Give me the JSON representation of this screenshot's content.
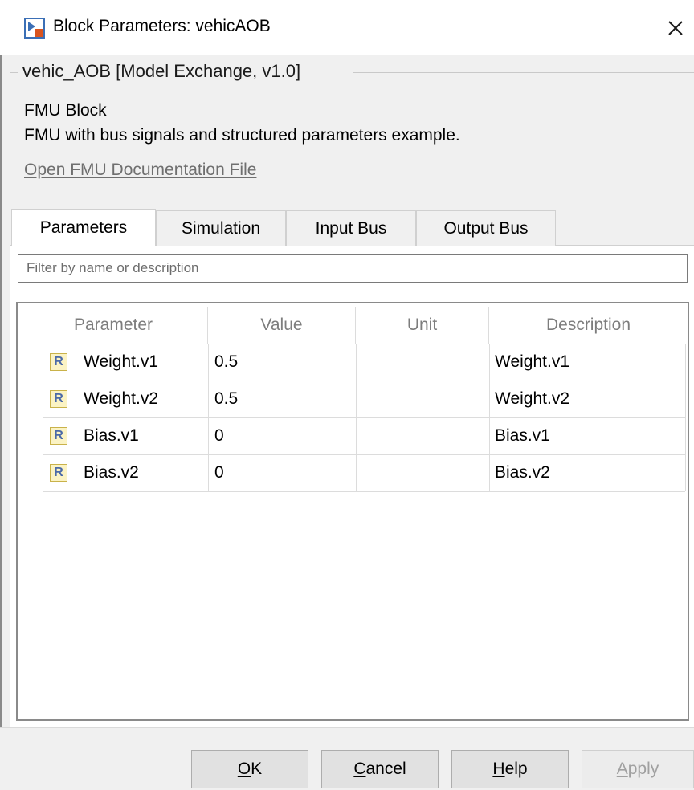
{
  "window": {
    "title": "Block Parameters: vehicAOB",
    "app_icon": "simulink-block-icon",
    "close_glyph": "✕"
  },
  "group": {
    "title": "vehic_AOB [Model Exchange, v1.0]",
    "block_type": "FMU Block",
    "description": "FMU with bus signals and structured parameters example.",
    "doc_link": "Open FMU Documentation File"
  },
  "tabs": [
    {
      "label": "Parameters",
      "active": true
    },
    {
      "label": "Simulation",
      "active": false
    },
    {
      "label": "Input Bus",
      "active": false
    },
    {
      "label": "Output Bus",
      "active": false
    }
  ],
  "filter": {
    "placeholder": "Filter by name or description",
    "value": ""
  },
  "table": {
    "columns": [
      "Parameter",
      "Value",
      "Unit",
      "Description"
    ],
    "rows": [
      {
        "type_badge": "R",
        "parameter": "Weight.v1",
        "value": "0.5",
        "unit": "",
        "description": "Weight.v1"
      },
      {
        "type_badge": "R",
        "parameter": "Weight.v2",
        "value": "0.5",
        "unit": "",
        "description": "Weight.v2"
      },
      {
        "type_badge": "R",
        "parameter": "Bias.v1",
        "value": "0",
        "unit": "",
        "description": "Bias.v1"
      },
      {
        "type_badge": "R",
        "parameter": "Bias.v2",
        "value": "0",
        "unit": "",
        "description": "Bias.v2"
      }
    ]
  },
  "buttons": {
    "ok": {
      "mnemonic": "O",
      "rest": "K"
    },
    "cancel": {
      "mnemonic": "C",
      "rest": "ancel"
    },
    "help": {
      "mnemonic": "H",
      "rest": "elp"
    },
    "apply": {
      "mnemonic": "A",
      "rest": "pply",
      "enabled": false
    }
  }
}
